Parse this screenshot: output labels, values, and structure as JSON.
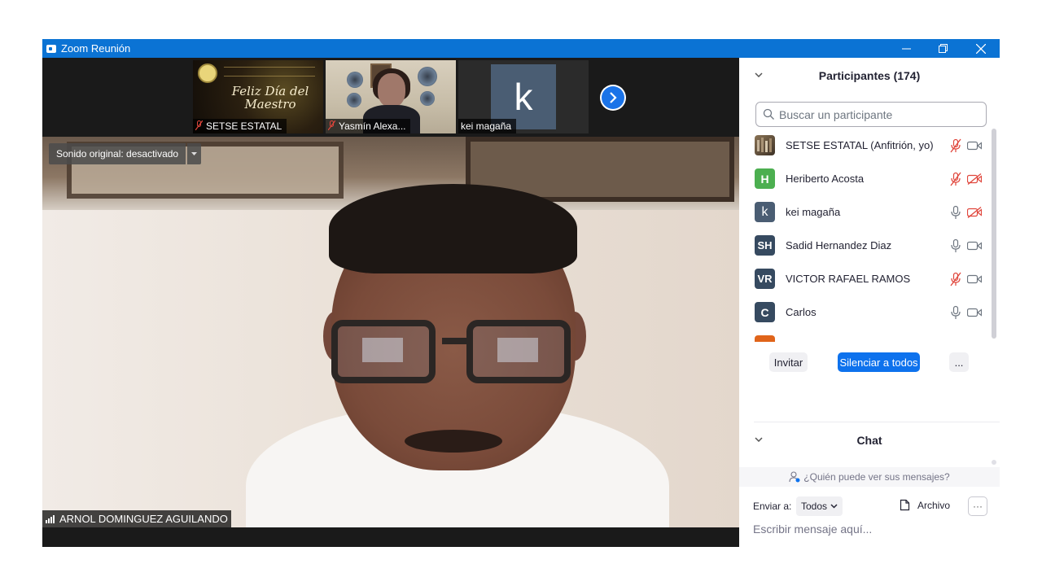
{
  "window": {
    "title": "Zoom Reunión",
    "controls": {
      "minimize": "—",
      "restore": "❐",
      "close": "✕"
    },
    "accent_color": "#0b73d4"
  },
  "thumbnails": [
    {
      "name": "SETSE ESTATAL",
      "muted": true,
      "banner_text": "Feliz Día del Maestro"
    },
    {
      "name": "Yasmín Alexa...",
      "muted": true
    },
    {
      "name": "kei magaña",
      "muted": false,
      "initial": "k"
    }
  ],
  "main_video": {
    "sound_label": "Sonido original: desactivado",
    "speaker_name": "ARNOL DOMINGUEZ AGUILANDO"
  },
  "participants": {
    "title": "Participantes (174)",
    "search_placeholder": "Buscar un participante",
    "items": [
      {
        "name": "SETSE ESTATAL (Anfitrión, yo)",
        "initial": "",
        "avatar_color": "#6d5a45",
        "mic": "muted",
        "video": "on"
      },
      {
        "name": "Heriberto Acosta",
        "initial": "H",
        "avatar_color": "#4caf50",
        "mic": "muted",
        "video": "off"
      },
      {
        "name": "kei magaña",
        "initial": "k",
        "avatar_color": "#4a5d73",
        "mic": "on",
        "video": "off"
      },
      {
        "name": "Sadid Hernandez Diaz",
        "initial": "SH",
        "avatar_color": "#364a60",
        "mic": "on",
        "video": "on"
      },
      {
        "name": "VICTOR RAFAEL RAMOS",
        "initial": "VR",
        "avatar_color": "#364a60",
        "mic": "muted",
        "video": "on"
      },
      {
        "name": "Carlos",
        "initial": "C",
        "avatar_color": "#364a60",
        "mic": "on",
        "video": "on"
      }
    ],
    "invite_label": "Invitar",
    "mute_all_label": "Silenciar a todos",
    "more_label": "..."
  },
  "chat": {
    "title": "Chat",
    "who_can_see": "¿Quién puede ver sus mensajes?",
    "send_to_label": "Enviar a:",
    "send_to_value": "Todos",
    "file_label": "Archivo",
    "more_label": "···",
    "input_placeholder": "Escribir mensaje aquí..."
  },
  "colors": {
    "muted_red": "#e0463c",
    "primary_blue": "#0e72ed"
  }
}
